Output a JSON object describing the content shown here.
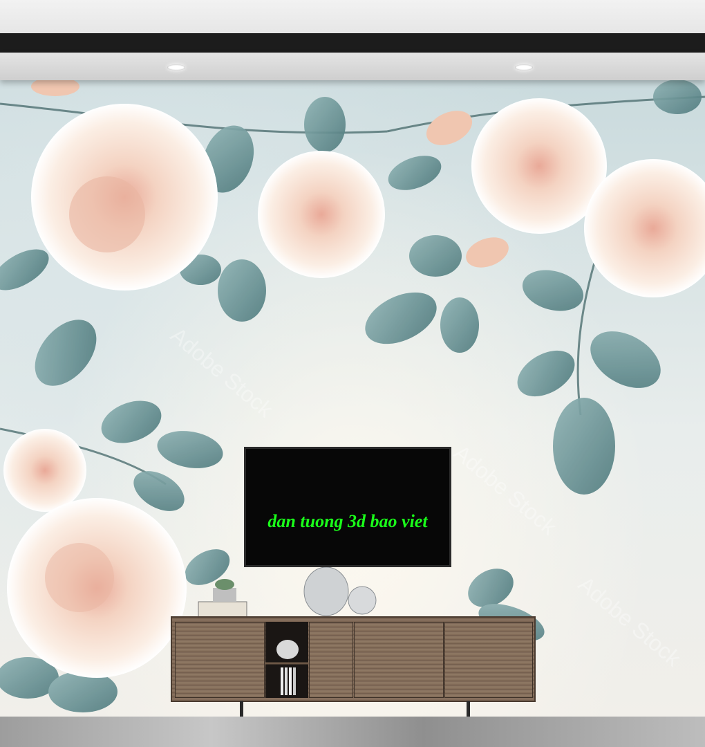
{
  "tv": {
    "caption": "dan tuong 3d bao viet"
  },
  "watermark": {
    "text": "Adobe Stock"
  },
  "colors": {
    "caption_green": "#1aff1a",
    "leaf": "#6f9597",
    "rose": "#f6dccb",
    "wall": "#dfe8e9"
  }
}
